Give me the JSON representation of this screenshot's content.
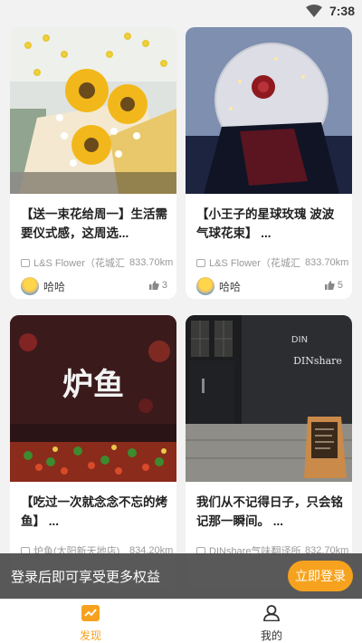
{
  "status_bar": {
    "time": "7:38",
    "icons": [
      "wifi-icon",
      "battery-icon"
    ]
  },
  "posts": [
    {
      "title": "【送一束花给周一】生活需要仪式感，这周选...",
      "shop_name": "L&S Flower（花城汇",
      "distance": "833.70km",
      "user": "哈哈",
      "likes": "3",
      "image": "sunflower-bouquet"
    },
    {
      "title": "【小王子的星球玫瑰 波波气球花束】 ...",
      "shop_name": "L&S Flower（花城汇",
      "distance": "833.70km",
      "user": "哈哈",
      "likes": "5",
      "image": "rose-balloon-bouquet"
    },
    {
      "title": "【吃过一次就念念不忘的烤鱼】 ...",
      "shop_name": "炉鱼(太阳新天地店)",
      "distance": "834.20km",
      "user": "",
      "likes": "",
      "image": "grilled-fish"
    },
    {
      "title": "我们从不记得日子，只会铭记那一瞬间。 ...",
      "shop_name": "DINshare气味翻译所",
      "distance": "832.70km",
      "user": "",
      "likes": "",
      "image": "storefront"
    }
  ],
  "photo_text": {
    "fish_sign": "炉鱼",
    "store_logo": "DINshare",
    "store_mark": "DIN"
  },
  "login_banner": {
    "message": "登录后即可享受更多权益",
    "button_label": "立即登录"
  },
  "tabs": [
    {
      "label": "发现",
      "icon": "discover-icon",
      "active": true
    },
    {
      "label": "我的",
      "icon": "profile-icon",
      "active": false
    }
  ],
  "colors": {
    "accent": "#f6a21e",
    "banner_bg": "#4b4b4b"
  }
}
